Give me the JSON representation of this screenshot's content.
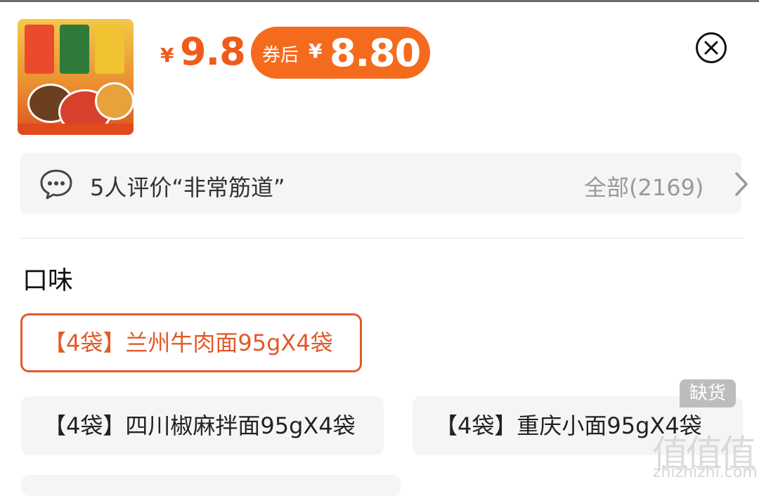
{
  "product": {
    "price_currency": "¥",
    "price": "9.8",
    "coupon_label": "券后",
    "coupon_currency": "¥",
    "coupon_price": "8.80"
  },
  "review": {
    "summary": "5人评价“非常筋道”",
    "all_link": "全部(2169)"
  },
  "options": {
    "section_title": "口味",
    "items": [
      {
        "label": "【4袋】兰州牛肉面95gX4袋",
        "selected": true
      },
      {
        "label": "【4袋】四川椒麻拌面95gX4袋",
        "selected": false
      },
      {
        "label": "【4袋】重庆小面95gX4袋",
        "selected": false,
        "badge": "缺货"
      }
    ]
  },
  "watermark": {
    "logo": "值值值",
    "url": "zhizhizhi.com"
  },
  "colors": {
    "accent": "#f05a1a",
    "coupon_bg": "#f56b1e",
    "selected_border": "#e15a2b",
    "chip_bg": "#f5f5f5"
  },
  "icons": [
    "chat-bubble-icon",
    "chevron-right-icon",
    "close-icon"
  ]
}
